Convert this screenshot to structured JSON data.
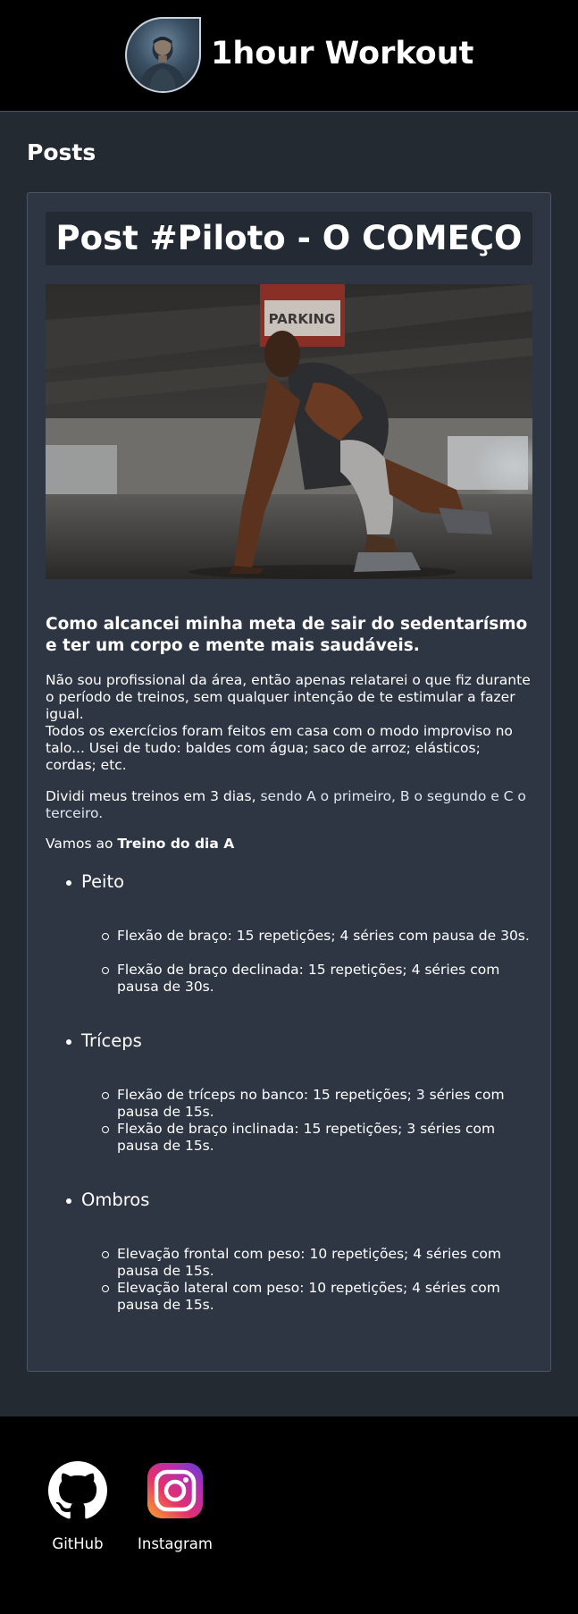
{
  "header": {
    "title": "1hour Workout",
    "avatar_icon": "profile-photo"
  },
  "section": {
    "title": "Posts"
  },
  "post": {
    "title": "Post #Piloto - O COMEÇO",
    "image_icon": "athlete-photo",
    "subtitle": "Como alcancei minha meta de sair do sedentarísmo e ter um corpo e mente mais saudáveis.",
    "intro": [
      "Não sou profissional da área, então apenas relatarei o que fiz durante o período de treinos, sem qualquer intenção de te estimular a fazer igual.",
      "Todos os exercícios foram feitos em casa com o modo improviso no talo... Usei de tudo: baldes com água; saco de arroz; elásticos; cordas; etc."
    ],
    "days_lead": "Dividi meus treinos em 3 dias, ",
    "days_rest": "sendo A o primeiro, B o segundo e C o terceiro.",
    "vamos_lead": "Vamos ao ",
    "vamos_bold": "Treino do dia A",
    "groups": [
      {
        "name": "Peito",
        "items": [
          "Flexão de braço: 15 repetições; 4 séries com pausa de 30s.",
          "Flexão de braço declinada: 15 repetições; 4 séries com pausa de 30s."
        ]
      },
      {
        "name": "Tríceps",
        "items": [
          "Flexão de tríceps no banco: 15 repetições; 3 séries com pausa de 15s.",
          "Flexão de braço inclinada: 15 repetições; 3 séries com pausa de 15s."
        ]
      },
      {
        "name": "Ombros",
        "items": [
          "Elevação frontal com peso: 10 repetições; 4 séries com pausa de 15s.",
          "Elevação lateral com peso: 10 repetições; 4 séries com pausa de 15s."
        ]
      }
    ]
  },
  "footer": {
    "links": [
      {
        "label": "GitHub",
        "icon": "github-icon"
      },
      {
        "label": "Instagram",
        "icon": "instagram-icon"
      }
    ]
  },
  "colors": {
    "page_bg": "#242a31",
    "header_bg": "#000000",
    "card_bg": "#2e3644",
    "title_bg": "#232a33",
    "text": "#ffffff"
  }
}
